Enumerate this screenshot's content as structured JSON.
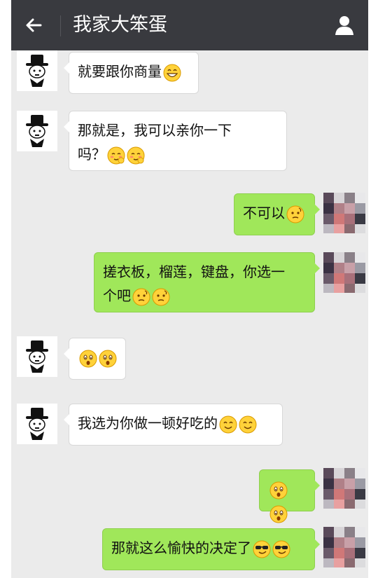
{
  "header": {
    "title": "我家大笨蛋",
    "back_icon": "back-arrow-icon",
    "profile_icon": "profile-icon"
  },
  "messages": [
    {
      "side": "left",
      "text": "就要跟你商量",
      "emoji": [
        "grin"
      ]
    },
    {
      "side": "left",
      "line1": "那就是，我可以亲你一下",
      "line2": "吗？",
      "emoji": [
        "shy",
        "shy"
      ]
    },
    {
      "side": "right",
      "text": "不可以",
      "emoji": [
        "think"
      ]
    },
    {
      "side": "right",
      "line1": "搓衣板，榴莲，键盘，你选一",
      "line2": "个吧",
      "emoji": [
        "think",
        "think"
      ]
    },
    {
      "side": "left",
      "text": "",
      "emoji": [
        "surprise",
        "surprise"
      ]
    },
    {
      "side": "left",
      "text": "我选为你做一顿好吃的",
      "emoji": [
        "smile",
        "smile"
      ]
    },
    {
      "side": "right",
      "text": "",
      "emoji": [
        "surprise",
        "surprise"
      ]
    },
    {
      "side": "right",
      "text": "那就这么愉快的决定了",
      "emoji": [
        "cool",
        "cool"
      ]
    }
  ],
  "colors": {
    "titlebar": "#393a3f",
    "chat_bg": "#ebebeb",
    "bubble_self": "#a0e75a",
    "bubble_other": "#ffffff"
  }
}
